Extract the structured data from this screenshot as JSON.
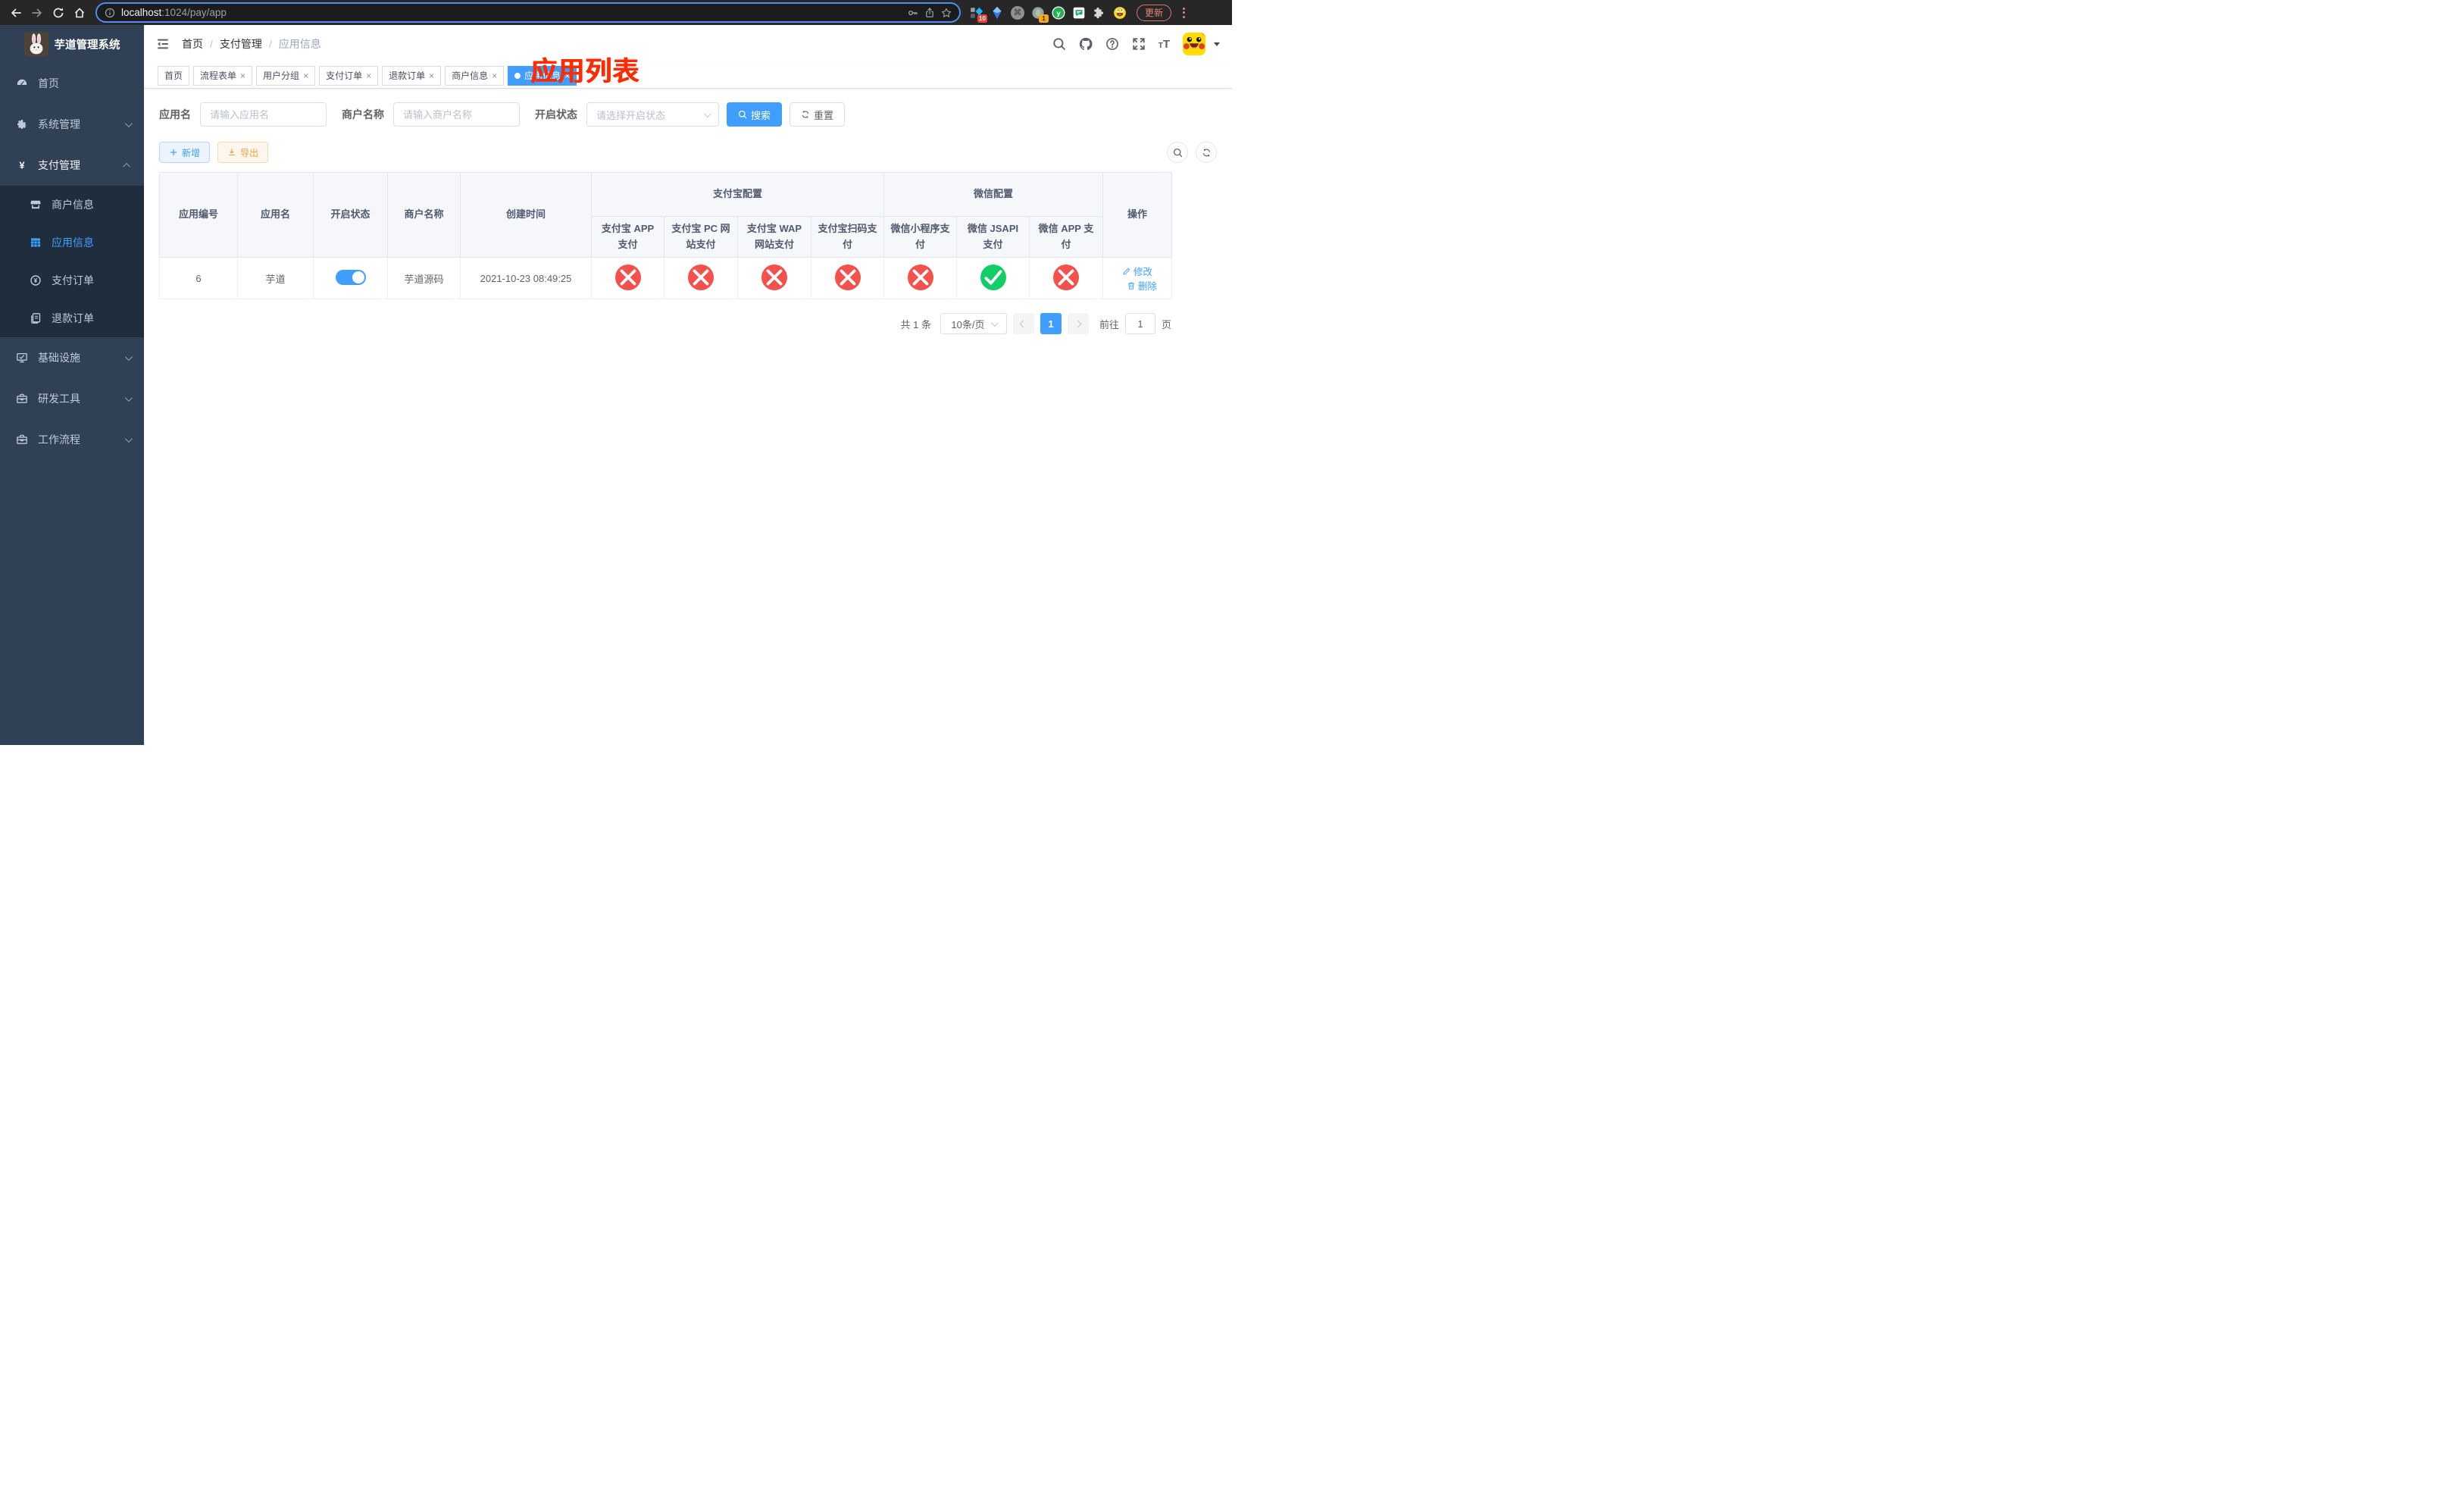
{
  "browser": {
    "url": {
      "host": "localhost",
      "path": ":1024/pay/app"
    },
    "update_button": "更新",
    "extension_badges": {
      "first": "10",
      "second": "1"
    }
  },
  "sidebar": {
    "title": "芋道管理系统",
    "menu": [
      {
        "key": "home",
        "label": "首页",
        "icon": "dashboard",
        "level": "top"
      },
      {
        "key": "system",
        "label": "系统管理",
        "icon": "gear",
        "level": "top",
        "chevron": "down"
      },
      {
        "key": "payment",
        "label": "支付管理",
        "icon": "yen",
        "level": "top",
        "chevron": "up",
        "expanded": true
      },
      {
        "key": "merchant-info",
        "label": "商户信息",
        "icon": "shop",
        "level": "sub"
      },
      {
        "key": "app-info",
        "label": "应用信息",
        "icon": "grid",
        "level": "sub",
        "active": true
      },
      {
        "key": "pay-order",
        "label": "支付订单",
        "icon": "coin",
        "level": "sub"
      },
      {
        "key": "refund-order",
        "label": "退款订单",
        "icon": "document",
        "level": "sub"
      },
      {
        "key": "infrastructure",
        "label": "基础设施",
        "icon": "monitor",
        "level": "top",
        "chevron": "down"
      },
      {
        "key": "dev-tools",
        "label": "研发工具",
        "icon": "toolbox",
        "level": "top",
        "chevron": "down"
      },
      {
        "key": "workflow",
        "label": "工作流程",
        "icon": "toolbox",
        "level": "top",
        "chevron": "down"
      }
    ]
  },
  "navbar": {
    "breadcrumb": [
      "首页",
      "支付管理",
      "应用信息"
    ]
  },
  "overlay_title": "应用列表",
  "tags": [
    {
      "key": "home",
      "label": "首页",
      "closable": false,
      "active": false
    },
    {
      "key": "flow-form",
      "label": "流程表单",
      "closable": true,
      "active": false
    },
    {
      "key": "user-group",
      "label": "用户分组",
      "closable": true,
      "active": false
    },
    {
      "key": "pay-order",
      "label": "支付订单",
      "closable": true,
      "active": false
    },
    {
      "key": "refund-order",
      "label": "退款订单",
      "closable": true,
      "active": false
    },
    {
      "key": "merchant-info",
      "label": "商户信息",
      "closable": true,
      "active": false
    },
    {
      "key": "app-info",
      "label": "应用信息",
      "closable": true,
      "active": true
    }
  ],
  "filters": {
    "app_name_label": "应用名",
    "app_name_placeholder": "请输入应用名",
    "merchant_label": "商户名称",
    "merchant_placeholder": "请输入商户名称",
    "status_label": "开启状态",
    "status_placeholder": "请选择开启状态",
    "search_label": "搜索",
    "reset_label": "重置"
  },
  "toolbar": {
    "add_label": "新增",
    "export_label": "导出"
  },
  "table": {
    "simple_columns": [
      "应用编号",
      "应用名",
      "开启状态",
      "商户名称",
      "创建时间"
    ],
    "groups": [
      {
        "label": "支付宝配置",
        "columns": [
          "支付宝 APP 支付",
          "支付宝 PC 网站支付",
          "支付宝 WAP 网站支付",
          "支付宝扫码支付"
        ]
      },
      {
        "label": "微信配置",
        "columns": [
          "微信小程序支付",
          "微信 JSAPI 支付",
          "微信 APP 支付"
        ]
      }
    ],
    "action_column": "操作",
    "rows": [
      {
        "id": "6",
        "name": "芋道",
        "enabled": true,
        "merchant": "芋道源码",
        "created": "2021-10-23 08:49:25",
        "statuses": [
          "disabled",
          "disabled",
          "disabled",
          "disabled",
          "disabled",
          "enabled",
          "disabled"
        ],
        "actions": [
          "修改",
          "删除"
        ]
      }
    ]
  },
  "pagination": {
    "total_text": "共 1 条",
    "page_size": "10条/页",
    "current_page": "1",
    "goto_label": "前往",
    "goto_value": "1",
    "page_unit": "页"
  },
  "colors": {
    "primary": "#409eff",
    "success": "#13ce66",
    "danger": "#f5504a",
    "warning": "#e6a23c",
    "sidebar_bg": "#304156",
    "submenu_bg": "#1f2d3d",
    "annotation_red": "#fe2b00"
  }
}
